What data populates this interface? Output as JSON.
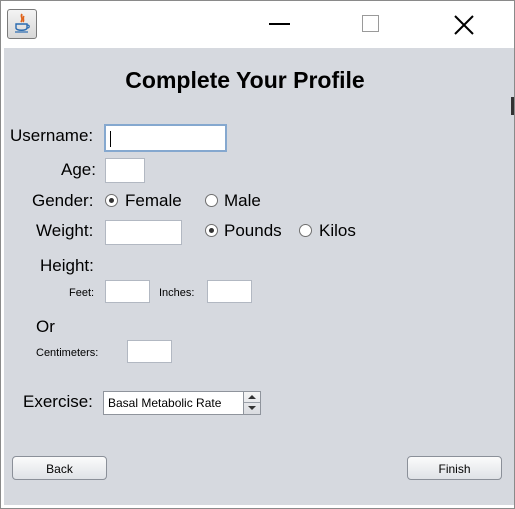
{
  "window": {
    "controls": {
      "minimize": "minimize-icon",
      "maximize": "maximize-icon",
      "close": "close-icon"
    }
  },
  "form": {
    "title": "Complete Your Profile",
    "username_label": "Username:",
    "username_value": "",
    "age_label": "Age:",
    "age_value": "",
    "gender_label": "Gender:",
    "gender_options": [
      "Female",
      "Male"
    ],
    "gender_selected": "Female",
    "weight_label": "Weight:",
    "weight_value": "",
    "weight_units": [
      "Pounds",
      "Kilos"
    ],
    "weight_unit_selected": "Pounds",
    "height_label": "Height:",
    "feet_label": "Feet:",
    "feet_value": "",
    "inches_label": "Inches:",
    "inches_value": "",
    "or_label": "Or",
    "centimeters_label": "Centimeters:",
    "centimeters_value": "",
    "exercise_label": "Exercise:",
    "exercise_selected": "Basal Metabolic Rate"
  },
  "buttons": {
    "back": "Back",
    "finish": "Finish"
  },
  "colors": {
    "panel": "#d6d9df",
    "focus_border": "#85a8cf"
  }
}
